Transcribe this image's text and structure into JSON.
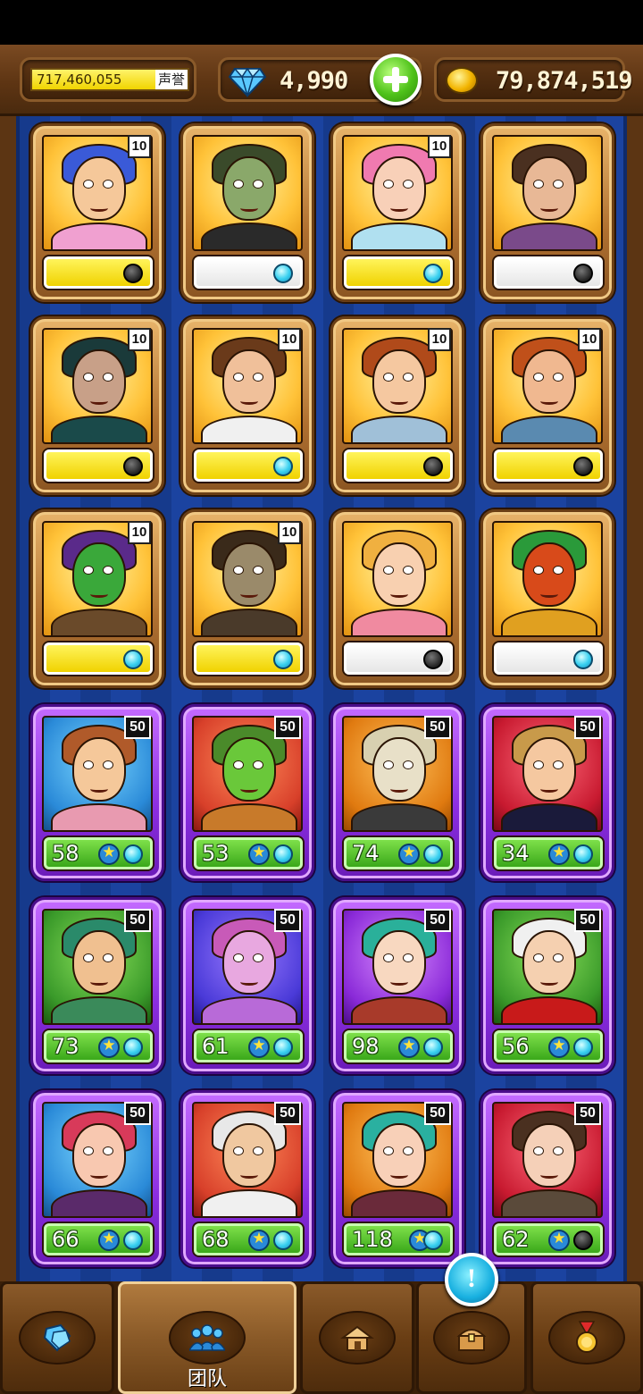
{
  "header": {
    "reputation_value": "717,460,055",
    "reputation_label": "声誉",
    "gems": "4,990",
    "gold": "79,874,519"
  },
  "heroes_common": [
    {
      "level": "10",
      "bar": "yellow",
      "dot": "off"
    },
    {
      "level": "",
      "bar": "white",
      "dot": "on"
    },
    {
      "level": "10",
      "bar": "yellow",
      "dot": "on"
    },
    {
      "level": "",
      "bar": "white",
      "dot": "off"
    },
    {
      "level": "10",
      "bar": "yellow",
      "dot": "off"
    },
    {
      "level": "10",
      "bar": "yellow",
      "dot": "on"
    },
    {
      "level": "10",
      "bar": "yellow",
      "dot": "off"
    },
    {
      "level": "10",
      "bar": "yellow",
      "dot": "off"
    },
    {
      "level": "10",
      "bar": "yellow",
      "dot": "on"
    },
    {
      "level": "10",
      "bar": "yellow",
      "dot": "on"
    },
    {
      "level": "",
      "bar": "white",
      "dot": "off"
    },
    {
      "level": "",
      "bar": "white",
      "dot": "on"
    }
  ],
  "heroes_epic": [
    {
      "level": "50",
      "count": "58",
      "dot": "on"
    },
    {
      "level": "50",
      "count": "53",
      "dot": "on"
    },
    {
      "level": "50",
      "count": "74",
      "dot": "on"
    },
    {
      "level": "50",
      "count": "34",
      "dot": "on"
    },
    {
      "level": "50",
      "count": "73",
      "dot": "on"
    },
    {
      "level": "50",
      "count": "61",
      "dot": "on"
    },
    {
      "level": "50",
      "count": "98",
      "dot": "on"
    },
    {
      "level": "50",
      "count": "56",
      "dot": "on"
    },
    {
      "level": "50",
      "count": "66",
      "dot": "on"
    },
    {
      "level": "50",
      "count": "68",
      "dot": "on"
    },
    {
      "level": "50",
      "count": "118",
      "dot": "on"
    },
    {
      "level": "50",
      "count": "62",
      "dot": "off"
    }
  ],
  "nav": {
    "team_label": "团队",
    "alert_symbol": "!",
    "items": [
      "gem-shop-icon",
      "team-icon",
      "home-icon",
      "chest-icon",
      "medal-icon"
    ]
  },
  "colors": {
    "wood": "#5c3513",
    "board_blue": "#163a8c",
    "bronze_card": "#b07030",
    "epic_card": "#8a2de0",
    "progress_yellow": "#f0d200",
    "count_green": "#3aa81a",
    "dot_active": "#38d0f0"
  }
}
